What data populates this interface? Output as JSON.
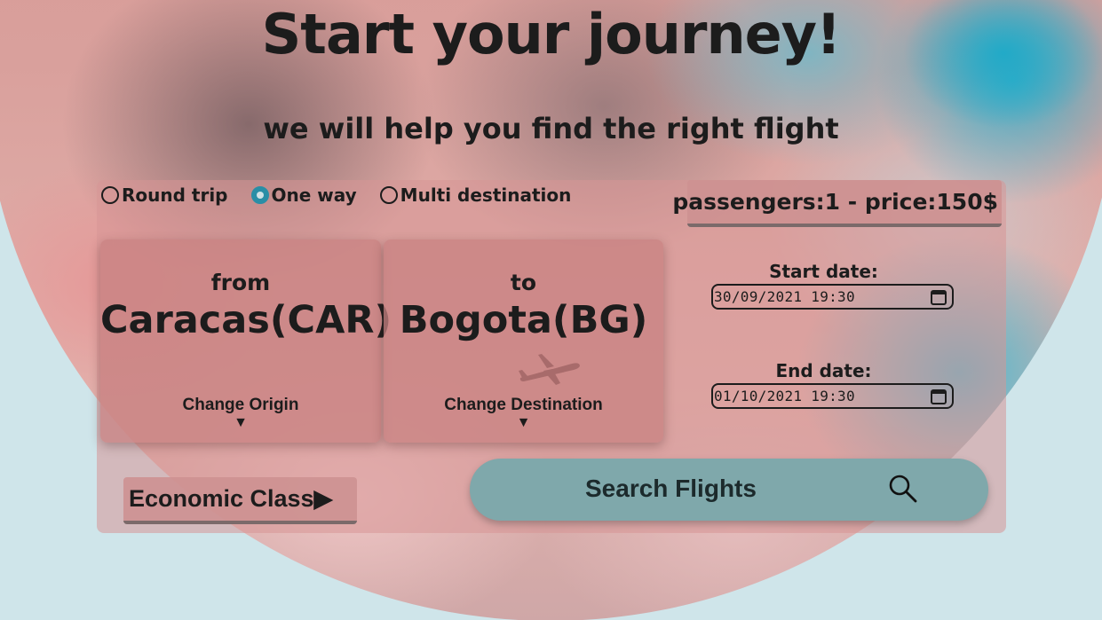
{
  "header": {
    "title": "Start your journey!",
    "subtitle": "we will help you find the right flight"
  },
  "trip_type": {
    "options": [
      "Round trip",
      "One way",
      "Multi destination"
    ],
    "selected": "One way"
  },
  "summary": {
    "text": "passengers:1 - price:150$"
  },
  "origin": {
    "label": "from",
    "city": "Caracas(CAR)",
    "change_label": "Change Origin",
    "caret": "▼"
  },
  "destination": {
    "label": "to",
    "city": "Bogota(BG)",
    "change_label": "Change Destination",
    "caret": "▼",
    "icon": "airplane-icon"
  },
  "dates": {
    "start_label": "Start date:",
    "start_value": "30/09/2021 19:30",
    "end_label": "End date:",
    "end_value": "01/10/2021 19:30",
    "icon": "calendar-icon"
  },
  "class_select": {
    "label": "Economic Class▶"
  },
  "search": {
    "label": "Search Flights",
    "icon": "search-icon"
  },
  "colors": {
    "accent": "#2a8ea6",
    "search_button": "#7fa8ab",
    "panel": "#d79696"
  }
}
